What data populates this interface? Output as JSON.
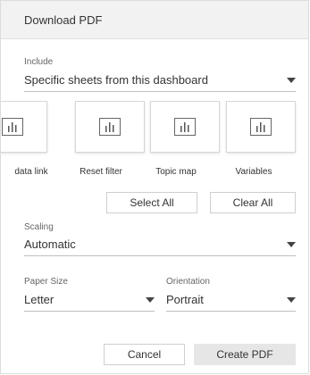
{
  "dialog": {
    "title": "Download PDF"
  },
  "include": {
    "label": "Include",
    "value": "Specific sheets from this dashboard"
  },
  "sheets": [
    {
      "name": "data link"
    },
    {
      "name": "Reset filter"
    },
    {
      "name": "Topic map"
    },
    {
      "name": "Variables"
    }
  ],
  "selection": {
    "select_all": "Select All",
    "clear_all": "Clear All"
  },
  "scaling": {
    "label": "Scaling",
    "value": "Automatic"
  },
  "paper_size": {
    "label": "Paper Size",
    "value": "Letter"
  },
  "orientation": {
    "label": "Orientation",
    "value": "Portrait"
  },
  "footer": {
    "cancel": "Cancel",
    "create": "Create PDF"
  },
  "colors": {
    "header_bg": "#f2f2f2",
    "primary_button_bg": "#e6e6e6",
    "text": "#333333"
  }
}
